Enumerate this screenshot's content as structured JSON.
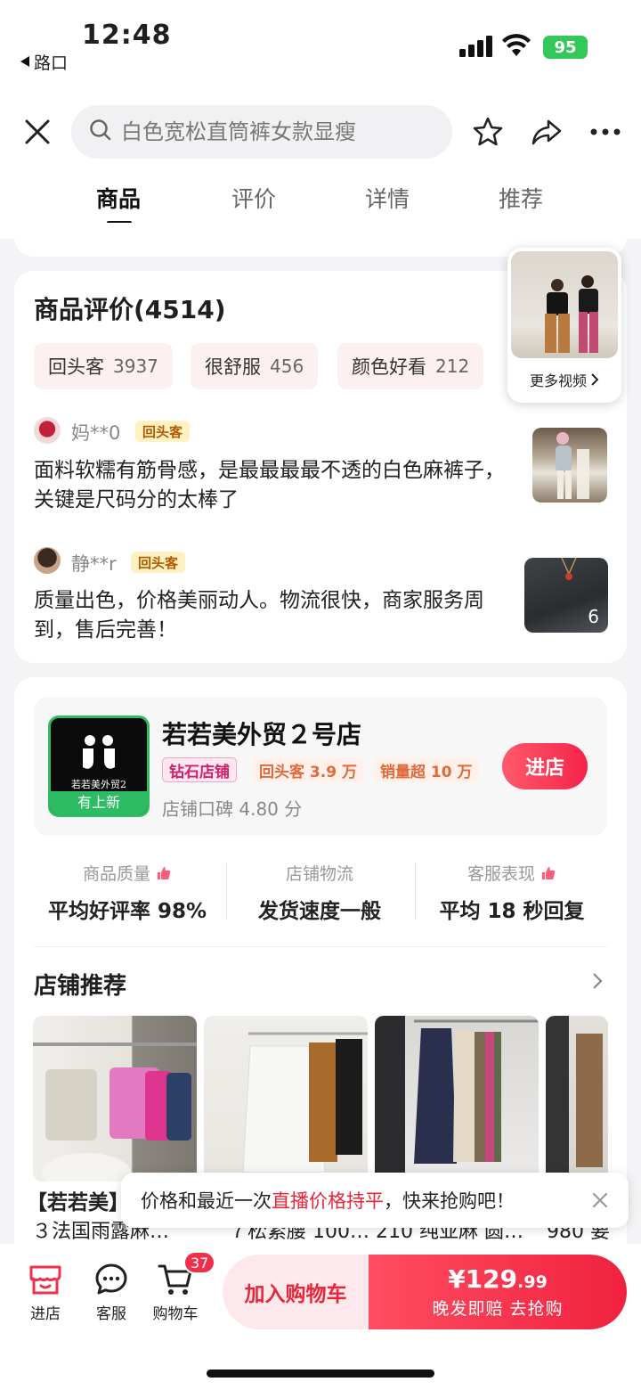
{
  "status_bar": {
    "time": "12:48",
    "back_label": "路口",
    "battery": "95"
  },
  "nav": {
    "search_placeholder": "白色宽松直筒裤女款显瘦",
    "tabs": [
      {
        "label": "商品"
      },
      {
        "label": "评价"
      },
      {
        "label": "详情"
      },
      {
        "label": "推荐"
      }
    ],
    "active_tab": "商品"
  },
  "reviews": {
    "title": "商品评价(4514)",
    "chips": [
      {
        "label": "回头客",
        "count": "3937"
      },
      {
        "label": "很舒服",
        "count": "456"
      },
      {
        "label": "颜色好看",
        "count": "212"
      }
    ],
    "items": [
      {
        "user": "妈**0",
        "badge": "回头客",
        "text": "面料软糯有筋骨感，是最最最最不透的白色麻裤子，关键是尺码分的太棒了",
        "image_count": ""
      },
      {
        "user": "静**r",
        "badge": "回头客",
        "text": "质量出色，价格美丽动人。物流很快，商家服务周到，售后完善！",
        "image_count": "6"
      }
    ],
    "video_label": "更多视频"
  },
  "shop": {
    "name": "若若美外贸２号店",
    "logo_text": "若若美外贸2",
    "logo_badge": "有上新",
    "tags": [
      "钻石店铺",
      "回头客 3.9 万",
      "销量超 10 万"
    ],
    "rating_label": "店铺口碑 4.80 分",
    "enter_label": "进店",
    "metrics": [
      {
        "label": "商品质量",
        "value": "平均好评率 98%",
        "thumb": true
      },
      {
        "label": "店铺物流",
        "value": "发货速度一般",
        "thumb": false
      },
      {
        "label": "客服表现",
        "value": "平均 18 秒回复",
        "thumb": true
      }
    ]
  },
  "recommend": {
    "title": "店铺推荐",
    "captions": [
      "【若若美】",
      "３法国雨露麻…",
      "７松紧腰 100…",
      "210 纯亚麻 圆…",
      "980 要"
    ]
  },
  "toast": {
    "pre": "价格和最近一次",
    "highlight": "直播价格持平",
    "post": "，快来抢购吧！"
  },
  "bottom": {
    "store_label": "进店",
    "service_label": "客服",
    "cart_label": "购物车",
    "cart_count": "37",
    "add_cart_label": "加入购物车",
    "price_main": "¥129",
    "price_decimal": ".99",
    "buy_sub": "晚发即赔  去抢购"
  },
  "colors": {
    "accent": "#f0213f",
    "chip_bg": "#fdf0f0",
    "shop_green": "#2dbb63"
  }
}
